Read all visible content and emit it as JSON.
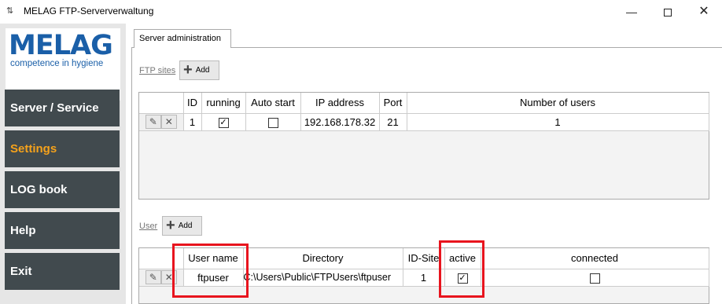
{
  "window": {
    "title": "MELAG FTP-Serververwaltung",
    "icon": "app-swap-icon",
    "min_label": "—",
    "close_label": "✕"
  },
  "logo": {
    "word": "MELAG",
    "tagline": "competence in hygiene"
  },
  "nav": {
    "server_service": "Server / Service",
    "settings": "Settings",
    "log_book": "LOG book",
    "help": "Help",
    "exit": "Exit"
  },
  "tabs": [
    {
      "label": "Server administration",
      "active": true
    }
  ],
  "ftp_sites": {
    "section_label": "FTP sites",
    "add_label": "Add",
    "columns": [
      "ID",
      "running",
      "Auto start",
      "IP address",
      "Port",
      "Number of users"
    ],
    "rows": [
      {
        "id": "1",
        "running": true,
        "auto_start": false,
        "ip": "192.168.178.32",
        "port": "21",
        "users": "1"
      }
    ]
  },
  "users": {
    "section_label": "User",
    "add_label": "Add",
    "columns": [
      "User name",
      "Directory",
      "ID-Site",
      "active",
      "connected"
    ],
    "rows": [
      {
        "user_name": "ftpuser",
        "directory": "C:\\Users\\Public\\FTPUsers\\ftpuser",
        "id_site": "1",
        "active": true,
        "connected": false
      }
    ]
  },
  "icons": {
    "edit": "pencil-icon",
    "delete": "x-icon",
    "add": "plus-icon"
  },
  "colors": {
    "nav_bg": "#414a4e",
    "nav_active": "#f5a21b",
    "logo_blue": "#1a5fa8",
    "highlight_red": "#e8141e"
  }
}
